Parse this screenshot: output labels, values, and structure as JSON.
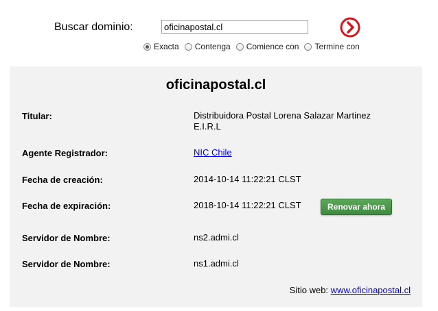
{
  "search": {
    "label": "Buscar dominio:",
    "value": "oficinapostal.cl",
    "options": [
      {
        "label": "Exacta",
        "checked": true
      },
      {
        "label": "Contenga",
        "checked": false
      },
      {
        "label": "Comience con",
        "checked": false
      },
      {
        "label": "Termine con",
        "checked": false
      }
    ],
    "go_icon": "arrow-circle-right-icon",
    "go_color": "#d9141b"
  },
  "result": {
    "domain": "oficinapostal.cl",
    "rows": [
      {
        "label": "Titular:",
        "value_line1": "Distribuidora Postal Lorena Salazar Martinez",
        "value_line2": "E.I.R.L"
      },
      {
        "label": "Agente Registrador:",
        "value": "NIC Chile"
      },
      {
        "label": "Fecha de creación:",
        "value": "2014-10-14 11:22:21 CLST"
      },
      {
        "label": "Fecha de expiración:",
        "value": "2018-10-14 11:22:21 CLST"
      },
      {
        "label": "Servidor de Nombre:",
        "value": "ns2.admi.cl"
      },
      {
        "label": "Servidor de Nombre:",
        "value": "ns1.admi.cl"
      }
    ],
    "renew_label": "Renovar ahora",
    "renew_color": "#4a9a4a",
    "site_label": "Sitio web:",
    "site_link": "www.oficinapostal.cl"
  }
}
